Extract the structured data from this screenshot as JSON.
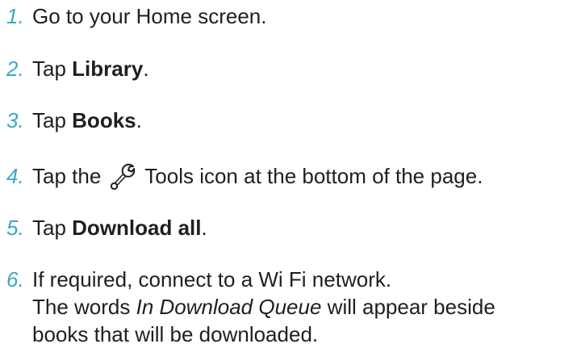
{
  "steps": [
    {
      "number": "1.",
      "text": "Go to your Home screen."
    },
    {
      "number": "2.",
      "prefix": "Tap ",
      "bold": "Library",
      "suffix": "."
    },
    {
      "number": "3.",
      "prefix": "Tap ",
      "bold": "Books",
      "suffix": "."
    },
    {
      "number": "4.",
      "prefix": "Tap the ",
      "icon": "wrench-icon",
      "suffix": " Tools icon at the bottom of the page."
    },
    {
      "number": "5.",
      "prefix": "Tap ",
      "bold": "Download all",
      "suffix": "."
    },
    {
      "number": "6.",
      "line1": "If required, connect to a Wi Fi network.",
      "line2_prefix": "The words ",
      "line2_italic": "In Download Queue",
      "line2_suffix": " will appear beside",
      "line3": "books that will be downloaded."
    }
  ],
  "colors": {
    "number": "#3aa8c4",
    "text": "#1f1f1f"
  }
}
